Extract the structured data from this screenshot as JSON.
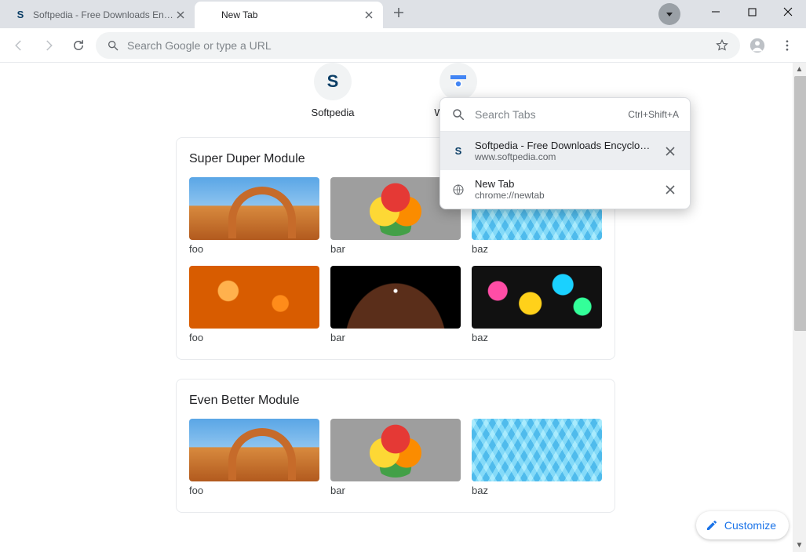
{
  "window": {
    "tabs": [
      {
        "title": "Softpedia - Free Downloads Encyc",
        "favicon": "softpedia",
        "active": false
      },
      {
        "title": "New Tab",
        "favicon": "none",
        "active": true
      }
    ]
  },
  "toolbar": {
    "omnibox_placeholder": "Search Google or type a URL"
  },
  "ntp": {
    "shortcuts": [
      {
        "label": "Softpedia",
        "glyph": "S"
      },
      {
        "label": "Web Store",
        "glyph": "◉"
      }
    ],
    "modules": [
      {
        "title": "Super Duper Module",
        "cards": [
          {
            "label": "foo",
            "art": "arch"
          },
          {
            "label": "bar",
            "art": "circles"
          },
          {
            "label": "baz",
            "art": "grid"
          },
          {
            "label": "foo",
            "art": "orange"
          },
          {
            "label": "bar",
            "art": "space"
          },
          {
            "label": "baz",
            "art": "splash"
          }
        ]
      },
      {
        "title": "Even Better Module",
        "cards": [
          {
            "label": "foo",
            "art": "arch"
          },
          {
            "label": "bar",
            "art": "circles"
          },
          {
            "label": "baz",
            "art": "grid"
          }
        ]
      }
    ]
  },
  "tab_search": {
    "placeholder": "Search Tabs",
    "shortcut": "Ctrl+Shift+A",
    "items": [
      {
        "title": "Softpedia - Free Downloads Encyclop…",
        "url": "www.softpedia.com",
        "favicon": "softpedia",
        "hover": true
      },
      {
        "title": "New Tab",
        "url": "chrome://newtab",
        "favicon": "globe",
        "hover": false
      }
    ]
  },
  "customize_label": "Customize"
}
